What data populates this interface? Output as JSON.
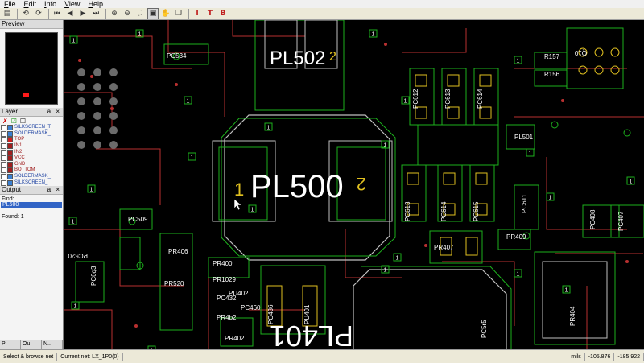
{
  "menu": [
    "File",
    "Edit",
    "Info",
    "View",
    "Help"
  ],
  "toolbar_icons": [
    "open-icon",
    "back-icon",
    "forward-icon",
    "first-icon",
    "prev-icon",
    "next-icon",
    "last-icon",
    "zoom-in-icon",
    "zoom-out-icon",
    "fit-icon",
    "select-icon",
    "hand-icon",
    "text-icon",
    "bold-t-icon"
  ],
  "panels": {
    "preview_title": "Preview",
    "layer_title": "Layer",
    "output_title": "Output",
    "title_buttons": "a ×"
  },
  "layers": [
    {
      "name": "SILKSCREEN_T",
      "color": "#3a7fd0"
    },
    {
      "name": "SOLDERMASK_",
      "color": "#3a7fd0"
    },
    {
      "name": "TOP",
      "color": "#d02020"
    },
    {
      "name": "IN1",
      "color": "#a02020"
    },
    {
      "name": "IN2",
      "color": "#a02020"
    },
    {
      "name": "VCC",
      "color": "#a02020"
    },
    {
      "name": "GND",
      "color": "#a02020"
    },
    {
      "name": "BOTTOM",
      "color": "#a02020"
    },
    {
      "name": "SOLDERMASK_",
      "color": "#3a7fd0"
    },
    {
      "name": "SILKSCREEN_",
      "color": "#3a7fd0"
    }
  ],
  "output": {
    "find_label": "Find:",
    "find_value": "PL500",
    "found_text": "Found: 1"
  },
  "left_tabs": [
    "Pi",
    "Ou",
    "N.."
  ],
  "status": {
    "mode": "Select & browse net",
    "net": "Current net: LX_1P0(0)",
    "units": "mils",
    "x": "-105.876",
    "y": "-185.922"
  },
  "board": {
    "big_labels": [
      "PL500",
      "PL502",
      "PL401"
    ],
    "parts": [
      "PC534",
      "R157",
      "R156",
      "Q10",
      "PC612",
      "PC613",
      "PC614",
      "PL501",
      "PC613",
      "PC614",
      "PC615",
      "PC611",
      "PC509",
      "PC520",
      "PR406",
      "PR407",
      "PR409",
      "PC408",
      "PC407",
      "PR400",
      "PR4b2",
      "PR520",
      "PR1029",
      "PC432",
      "PC436",
      "PU401",
      "PR404",
      "PR402",
      "PC460",
      "PU402",
      "PC6q3",
      "PC5r5"
    ],
    "pin_numbers": [
      "1",
      "2"
    ],
    "marker": "1"
  },
  "colors": {
    "trace": "#b83030",
    "outline": "#1db01d",
    "pad": "#e0c020",
    "silk": "#ffffff"
  }
}
